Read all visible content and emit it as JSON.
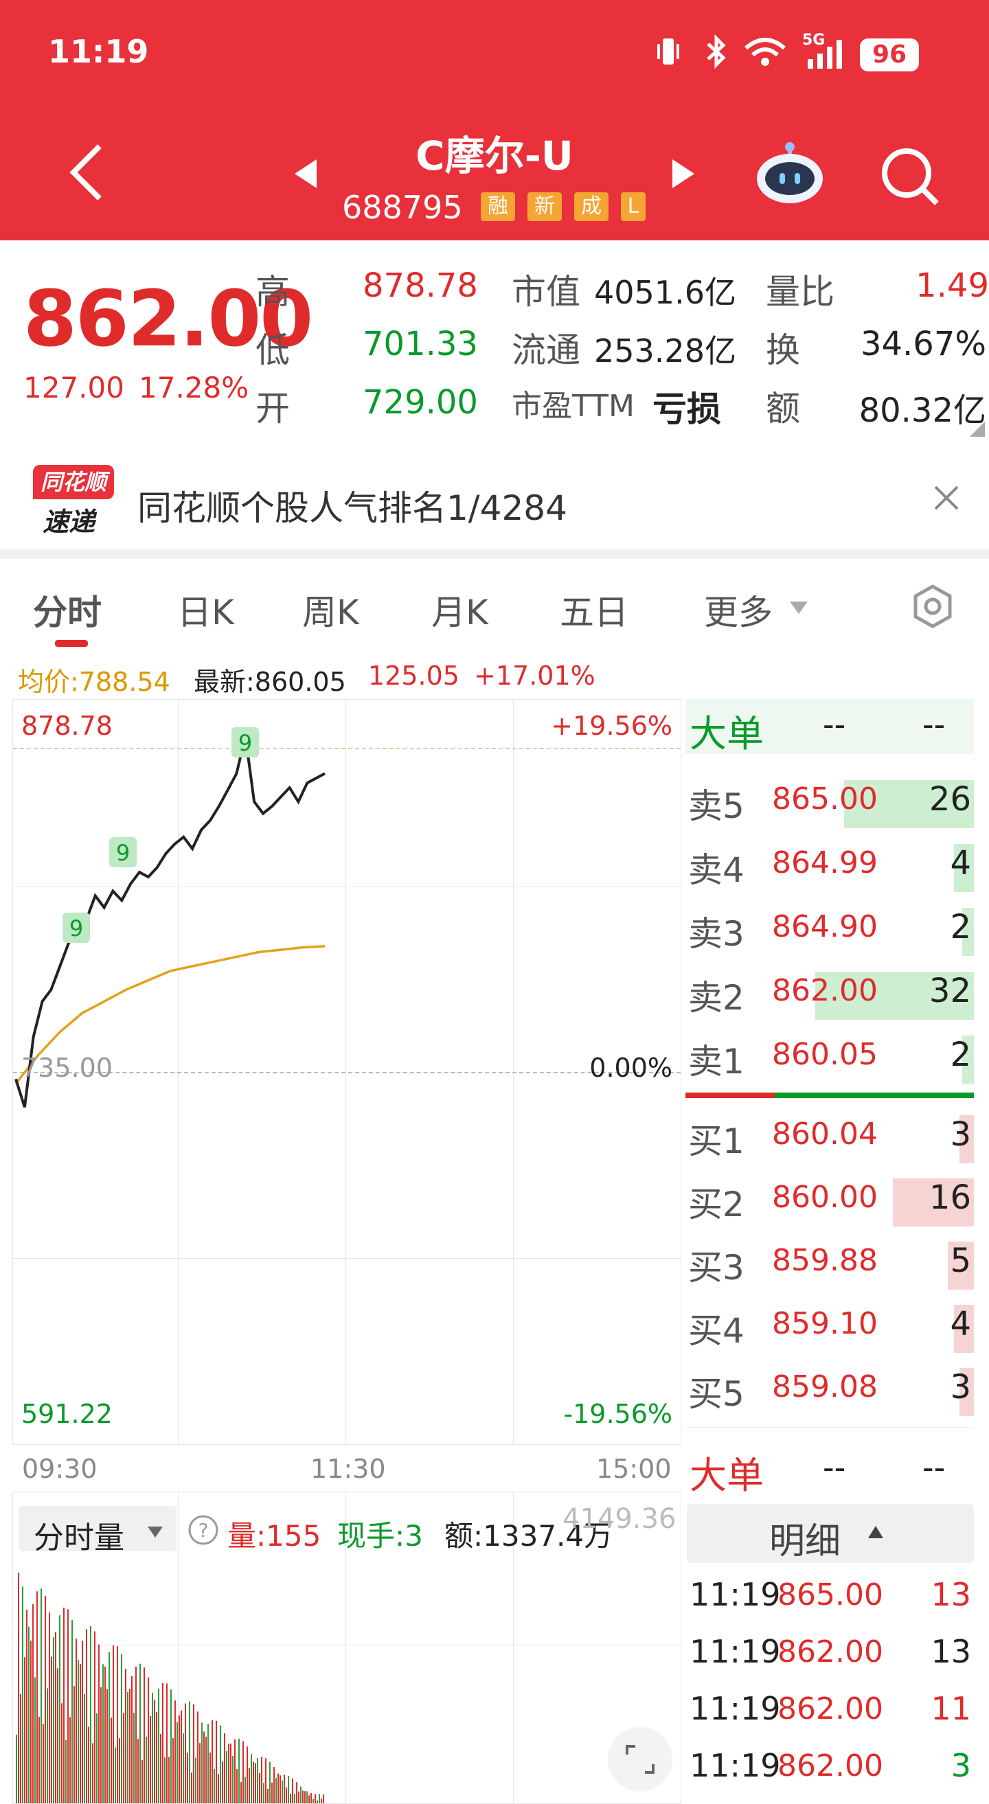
{
  "status_bar": {
    "time": "11:19",
    "network": "5G",
    "battery": "96"
  },
  "header": {
    "title": "C摩尔-U",
    "code": "688795",
    "tags": [
      "融",
      "新",
      "成",
      "L"
    ],
    "icons": [
      "back-icon",
      "prev-stock-icon",
      "next-stock-icon",
      "robot-assistant-icon",
      "search-icon"
    ]
  },
  "quote": {
    "price": "862.00",
    "change": "127.00",
    "change_pct": "17.28%",
    "stats": [
      {
        "label": "高",
        "value": "878.78",
        "color": "red"
      },
      {
        "label": "低",
        "value": "701.33",
        "color": "green"
      },
      {
        "label": "开",
        "value": "729.00",
        "color": "green"
      }
    ],
    "metrics": [
      {
        "label": "市值",
        "value": "4051.6亿"
      },
      {
        "label": "流通",
        "value": "253.28亿"
      },
      {
        "label": "市盈TTM",
        "value": "亏损"
      }
    ],
    "ratios": [
      {
        "label": "量比",
        "value": "1.49",
        "color": "red"
      },
      {
        "label": "换",
        "value": "34.67%",
        "color": "dark"
      },
      {
        "label": "额",
        "value": "80.32亿",
        "color": "dark"
      }
    ]
  },
  "notice": {
    "logo_line1": "同花顺",
    "logo_line2": "速递",
    "text": "同花顺个股人气排名1/4284"
  },
  "tabs": [
    "分时",
    "日K",
    "周K",
    "月K",
    "五日",
    "更多"
  ],
  "chart_info": {
    "avg_label": "均价:788.54",
    "latest_label": "最新:860.05",
    "change": "125.05",
    "change_pct": "+17.01%"
  },
  "chart_axes": {
    "y_top": "878.78",
    "y_mid": "735.00",
    "y_bottom": "591.22",
    "pct_top": "+19.56%",
    "pct_mid": "0.00%",
    "pct_bottom": "-19.56%",
    "x_labels": [
      "09:30",
      "11:30",
      "15:00"
    ]
  },
  "signal_marks": [
    "9",
    "9",
    "9"
  ],
  "chart_data": {
    "type": "line",
    "x_label_ticks": [
      "09:30",
      "11:30",
      "15:00"
    ],
    "ylim": [
      591.22,
      878.78
    ],
    "series": [
      {
        "name": "最新",
        "values": [
          732,
          720,
          750,
          765,
          770,
          780,
          790,
          795,
          800,
          810,
          805,
          812,
          808,
          815,
          820,
          818,
          822,
          828,
          832,
          835,
          830,
          838,
          842,
          848,
          855,
          862,
          878,
          850,
          845,
          848,
          852,
          856,
          850,
          858,
          860,
          862
        ]
      },
      {
        "name": "均价",
        "values": [
          730,
          742,
          752,
          760,
          765,
          770,
          774,
          778,
          780,
          782,
          784,
          786,
          787,
          788,
          788.5
        ]
      }
    ]
  },
  "order_book": {
    "header": {
      "label": "大单",
      "v1": "--",
      "v2": "--"
    },
    "asks": [
      {
        "label": "卖5",
        "price": "865.00",
        "vol": "26",
        "bar": 0.45
      },
      {
        "label": "卖4",
        "price": "864.99",
        "vol": "4",
        "bar": 0.07
      },
      {
        "label": "卖3",
        "price": "864.90",
        "vol": "2",
        "bar": 0.04
      },
      {
        "label": "卖2",
        "price": "862.00",
        "vol": "32",
        "bar": 0.55
      },
      {
        "label": "卖1",
        "price": "860.05",
        "vol": "2",
        "bar": 0.04
      }
    ],
    "bids": [
      {
        "label": "买1",
        "price": "860.04",
        "vol": "3",
        "bar": 0.05
      },
      {
        "label": "买2",
        "price": "860.00",
        "vol": "16",
        "bar": 0.28
      },
      {
        "label": "买3",
        "price": "859.88",
        "vol": "5",
        "bar": 0.09
      },
      {
        "label": "买4",
        "price": "859.10",
        "vol": "4",
        "bar": 0.07
      },
      {
        "label": "买5",
        "price": "859.08",
        "vol": "3",
        "bar": 0.05
      }
    ],
    "footer": {
      "label": "大单",
      "v1": "--",
      "v2": "--"
    }
  },
  "volume": {
    "selector": "分时量",
    "vol_label": "量:155",
    "hand_label": "现手:3",
    "amount_label": "额:1337.4万",
    "scale": "4149.36"
  },
  "detail": {
    "title": "明细",
    "rows": [
      {
        "time": "11:19",
        "price": "865.00",
        "vol": "13",
        "color": "red"
      },
      {
        "time": "11:19",
        "price": "862.00",
        "vol": "13",
        "color": "dark"
      },
      {
        "time": "11:19",
        "price": "862.00",
        "vol": "11",
        "color": "red"
      },
      {
        "time": "11:19",
        "price": "862.00",
        "vol": "3",
        "color": "green"
      }
    ]
  }
}
